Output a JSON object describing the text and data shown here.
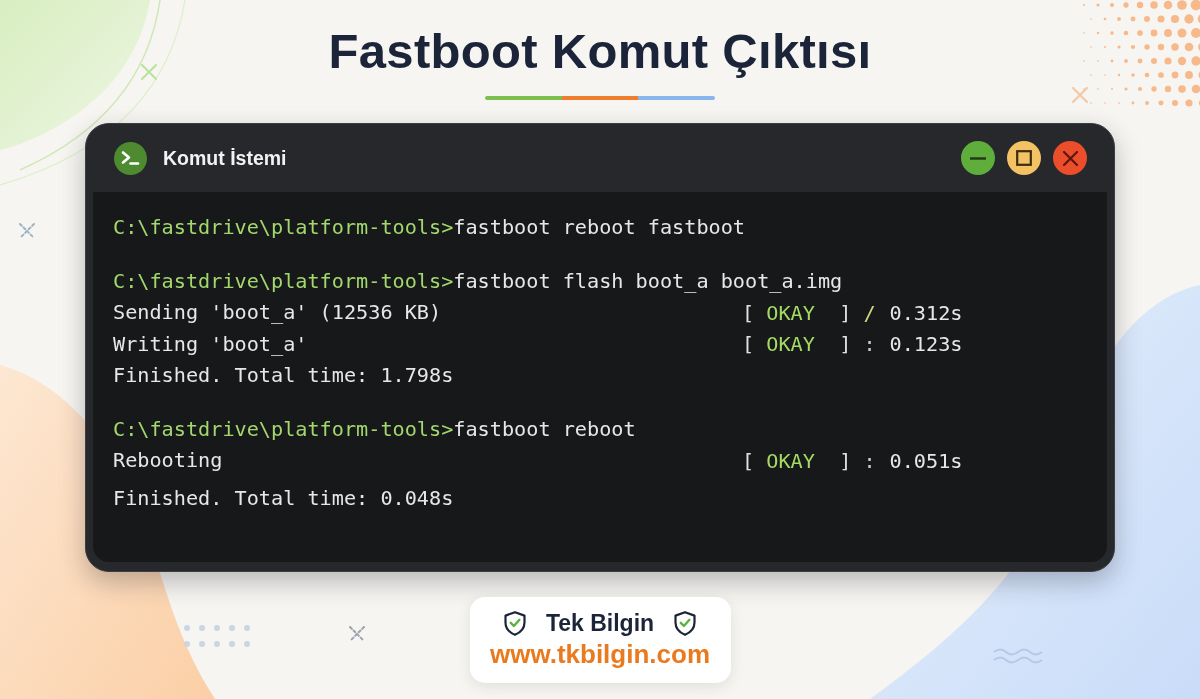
{
  "page": {
    "title": "Fastboot Komut Çıktısı"
  },
  "window": {
    "title": "Komut İstemi",
    "controls": [
      {
        "kind": "minimize"
      },
      {
        "kind": "maximize"
      },
      {
        "kind": "close"
      }
    ]
  },
  "terminal": {
    "blocks": [
      {
        "lines": [
          {
            "kind": "prompt",
            "path": "C:\\fastdrive\\platform-tools>",
            "command": "fastboot reboot fastboot"
          }
        ]
      },
      {
        "lines": [
          {
            "kind": "prompt",
            "path": "C:\\fastdrive\\platform-tools>",
            "command": "fastboot flash boot_a boot_a.img"
          },
          {
            "kind": "status",
            "text": "Sending 'boot_a' (12536 KB)",
            "status": {
              "open": "[",
              "label": "OKAY",
              "close": "]",
              "separator": "/",
              "time": "0.312s"
            }
          },
          {
            "kind": "status",
            "text": "Writing 'boot_a'",
            "status": {
              "open": "[",
              "label": "OKAY",
              "close": "]",
              "separator": ":",
              "time": "0.123s"
            }
          },
          {
            "kind": "output",
            "text": "Finished. Total time: 1.798s"
          }
        ]
      },
      {
        "lines": [
          {
            "kind": "prompt",
            "path": "C:\\fastdrive\\platform-tools>",
            "command": "fastboot reboot"
          },
          {
            "kind": "status",
            "text": "Rebooting",
            "status": {
              "open": "[",
              "label": "OKAY",
              "close": "]",
              "separator": ":",
              "time": "0.051s"
            }
          },
          {
            "kind": "output",
            "text": "Finished. Total time: 0.048s"
          }
        ]
      }
    ]
  },
  "brand": {
    "name": "Tek Bilgin",
    "url": "www.tkbilgin.com"
  }
}
